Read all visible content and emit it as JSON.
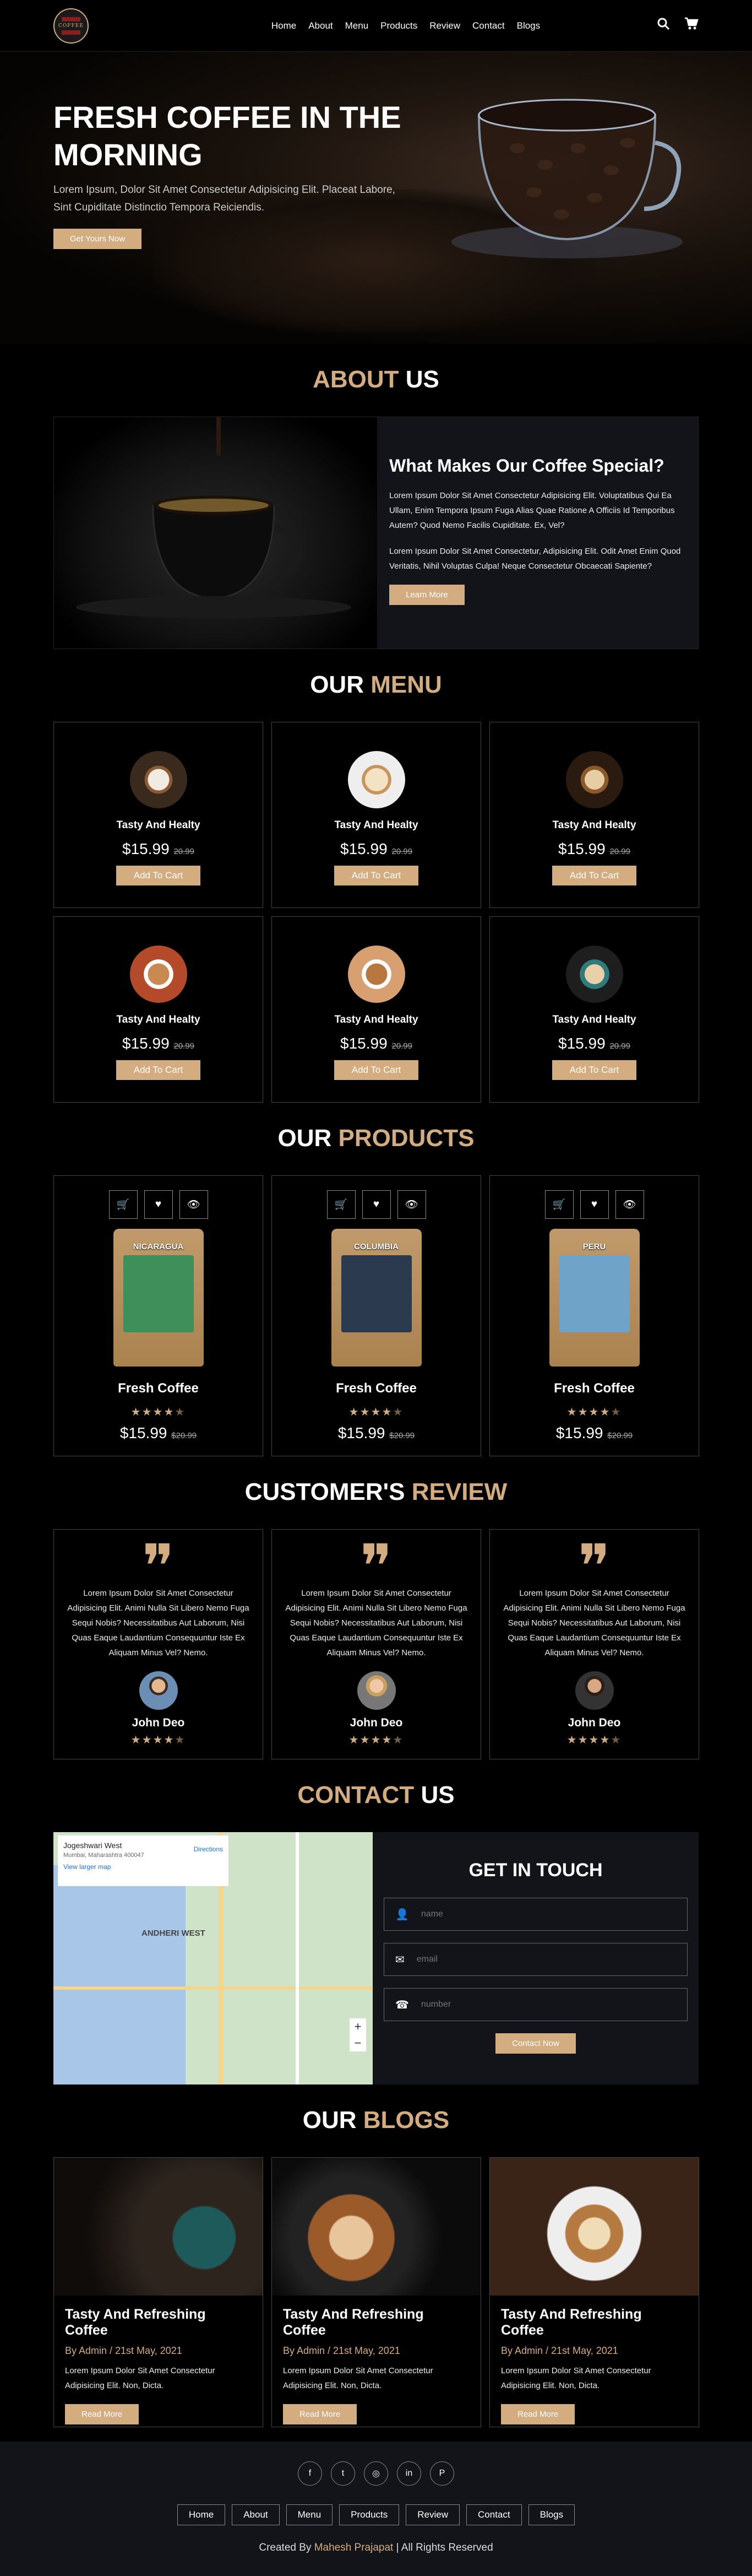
{
  "nav": {
    "logo_text": "COFFEE",
    "links": [
      "Home",
      "About",
      "Menu",
      "Products",
      "Review",
      "Contact",
      "Blogs"
    ],
    "search_icon": "search-icon",
    "cart_icon": "cart-icon"
  },
  "hero": {
    "title": "FRESH COFFEE IN THE MORNING",
    "text": "Lorem Ipsum, Dolor Sit Amet Consectetur Adipisicing Elit. Placeat Labore, Sint Cupiditate Distinctio Tempora Reiciendis.",
    "button": "Get Yours Now"
  },
  "about": {
    "title_a": "ABOUT",
    "title_b": "US",
    "heading": "What Makes Our Coffee Special?",
    "p1": "Lorem Ipsum Dolor Sit Amet Consectetur Adipisicing Elit. Voluptatibus Qui Ea Ullam, Enim Tempora Ipsum Fuga Alias Quae Ratione A Officiis Id Temporibus Autem? Quod Nemo Facilis Cupiditate. Ex, Vel?",
    "p2": "Lorem Ipsum Dolor Sit Amet Consectetur, Adipisicing Elit. Odit Amet Enim Quod Veritatis, Nihil Voluptas Culpa! Neque Consectetur Obcaecati Sapiente?",
    "button": "Learn More"
  },
  "menu": {
    "title_a": "OUR",
    "title_b": "MENU",
    "items": [
      {
        "name": "Tasty And Healty",
        "price": "$15.99",
        "old": "20.99",
        "button": "Add To Cart"
      },
      {
        "name": "Tasty And Healty",
        "price": "$15.99",
        "old": "20.99",
        "button": "Add To Cart"
      },
      {
        "name": "Tasty And Healty",
        "price": "$15.99",
        "old": "20.99",
        "button": "Add To Cart"
      },
      {
        "name": "Tasty And Healty",
        "price": "$15.99",
        "old": "20.99",
        "button": "Add To Cart"
      },
      {
        "name": "Tasty And Healty",
        "price": "$15.99",
        "old": "20.99",
        "button": "Add To Cart"
      },
      {
        "name": "Tasty And Healty",
        "price": "$15.99",
        "old": "20.99",
        "button": "Add To Cart"
      }
    ]
  },
  "products": {
    "title_a": "OUR",
    "title_b": "PRODUCTS",
    "items": [
      {
        "bag": "NICARAGUA",
        "name": "Fresh Coffee",
        "price": "$15.99",
        "old": "$20.99",
        "rating": 4.5,
        "label_color": "#3e8f5a"
      },
      {
        "bag": "COLUMBIA",
        "name": "Fresh Coffee",
        "price": "$15.99",
        "old": "$20.99",
        "rating": 4.5,
        "label_color": "#2b3a4e"
      },
      {
        "bag": "PERU",
        "name": "Fresh Coffee",
        "price": "$15.99",
        "old": "$20.99",
        "rating": 4.5,
        "label_color": "#6fa3c7"
      }
    ]
  },
  "reviews": {
    "title_a": "CUSTOMER'S",
    "title_b": "REVIEW",
    "items": [
      {
        "text": "Lorem Ipsum Dolor Sit Amet Consectetur Adipisicing Elit. Animi Nulla Sit Libero Nemo Fuga Sequi Nobis? Necessitatibus Aut Laborum, Nisi Quas Eaque Laudantium Consequuntur Iste Ex Aliquam Minus Vel? Nemo.",
        "name": "John Deo",
        "rating": 4.5
      },
      {
        "text": "Lorem Ipsum Dolor Sit Amet Consectetur Adipisicing Elit. Animi Nulla Sit Libero Nemo Fuga Sequi Nobis? Necessitatibus Aut Laborum, Nisi Quas Eaque Laudantium Consequuntur Iste Ex Aliquam Minus Vel? Nemo.",
        "name": "John Deo",
        "rating": 4.5
      },
      {
        "text": "Lorem Ipsum Dolor Sit Amet Consectetur Adipisicing Elit. Animi Nulla Sit Libero Nemo Fuga Sequi Nobis? Necessitatibus Aut Laborum, Nisi Quas Eaque Laudantium Consequuntur Iste Ex Aliquam Minus Vel? Nemo.",
        "name": "John Deo",
        "rating": 4.5
      }
    ]
  },
  "contact": {
    "title_a": "CONTACT",
    "title_b": "US",
    "map_place": "Jogeshwari West",
    "map_address": "Mumbai, Maharashtra 400047",
    "map_link": "View larger map",
    "map_directions": "Directions",
    "map_label": "ANDHERI WEST",
    "form_title": "GET IN TOUCH",
    "name_ph": "name",
    "email_ph": "email",
    "number_ph": "number",
    "button": "Contact Now"
  },
  "blogs": {
    "title_a": "OUR",
    "title_b": "BLOGS",
    "items": [
      {
        "title": "Tasty And Refreshing Coffee",
        "by": "By Admin / 21st May, 2021",
        "text": "Lorem Ipsum Dolor Sit Amet Consectetur Adipisicing Elit. Non, Dicta.",
        "button": "Read More"
      },
      {
        "title": "Tasty And Refreshing Coffee",
        "by": "By Admin / 21st May, 2021",
        "text": "Lorem Ipsum Dolor Sit Amet Consectetur Adipisicing Elit. Non, Dicta.",
        "button": "Read More"
      },
      {
        "title": "Tasty And Refreshing Coffee",
        "by": "By Admin / 21st May, 2021",
        "text": "Lorem Ipsum Dolor Sit Amet Consectetur Adipisicing Elit. Non, Dicta.",
        "button": "Read More"
      }
    ]
  },
  "footer": {
    "social": [
      "f",
      "t",
      "◎",
      "in",
      "P"
    ],
    "links": [
      "Home",
      "About",
      "Menu",
      "Products",
      "Review",
      "Contact",
      "Blogs"
    ],
    "credit_a": "Created By",
    "credit_name": "Mahesh Prajapat",
    "credit_b": "| All Rights Reserved"
  },
  "colors": {
    "accent": "#d3ad7f",
    "background": "#000000",
    "card": "#13131a"
  }
}
